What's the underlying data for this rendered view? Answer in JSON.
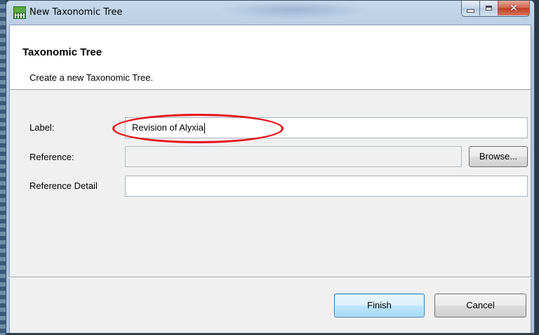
{
  "window": {
    "title": "New Taxonomic Tree",
    "icon": "eclipse-app-icon",
    "controls": [
      "minimize",
      "maximize",
      "close"
    ]
  },
  "banner": {
    "title": "Taxonomic Tree",
    "description": "Create a new Taxonomic Tree."
  },
  "form": {
    "label": {
      "label": "Label:",
      "value": "Revision of Alyxia"
    },
    "reference": {
      "label": "Reference:",
      "value": "",
      "button": "Browse..."
    },
    "reference_detail": {
      "label": "Reference Detail",
      "value": ""
    }
  },
  "buttons": {
    "finish": "Finish",
    "cancel": "Cancel"
  },
  "colors": {
    "annotation": "#e8121a",
    "default_button_border": "#3c7fb1"
  }
}
